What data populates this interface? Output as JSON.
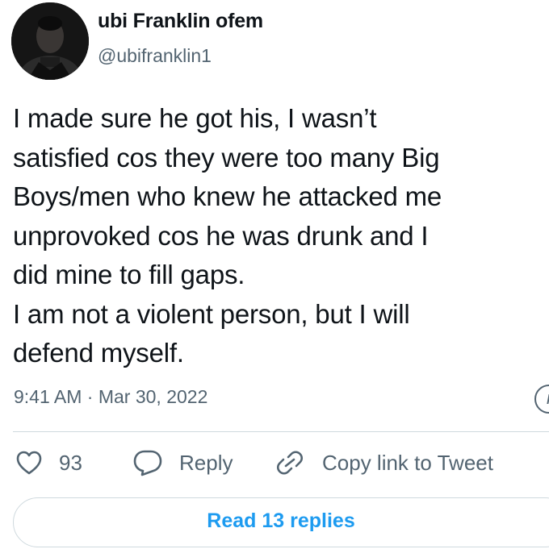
{
  "user": {
    "display_name": "ubi Franklin ofem",
    "handle": "@ubifranklin1",
    "avatar_icon": "profile-photo"
  },
  "tweet": {
    "text": "I made sure he got his, I wasn’t\nsatisfied cos they were too many Big\nBoys/men who knew he attacked me\nunprovoked cos he was drunk and I\ndid mine to fill gaps.\nI am not a violent person, but I will\ndefend myself.",
    "timestamp": "9:41 AM · Mar 30, 2022"
  },
  "actions": {
    "like_count": "93",
    "reply_label": "Reply",
    "copy_link_label": "Copy link to Tweet"
  },
  "replies": {
    "label": "Read 13 replies"
  },
  "colors": {
    "text": "#0f1419",
    "secondary": "#536471",
    "accent": "#1d9bf0",
    "border": "#cfd9de"
  }
}
